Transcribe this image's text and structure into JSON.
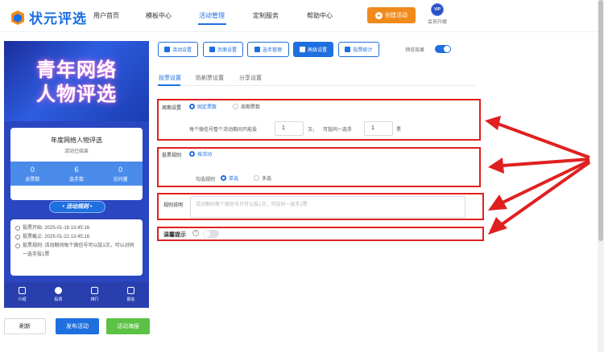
{
  "brand": {
    "name": "状元评选"
  },
  "nav": {
    "items": [
      {
        "label": "用户首页"
      },
      {
        "label": "模板中心"
      },
      {
        "label": "活动管理"
      },
      {
        "label": "定制服务"
      },
      {
        "label": "帮助中心"
      }
    ],
    "active_index": 2,
    "create_button": "创建活动",
    "vip_badge": "VIP",
    "vip_label": "会员升级"
  },
  "preview": {
    "hero_line1": "青年网络",
    "hero_line2": "人物评选",
    "title": "年度网络人物评选",
    "status": "活动已结束",
    "stats": [
      {
        "value": "0",
        "label": "总票数"
      },
      {
        "value": "6",
        "label": "选手数"
      },
      {
        "value": "0",
        "label": "访问量"
      }
    ],
    "rules_button": "• 活动规则 •",
    "info": [
      {
        "text": "投票开始: 2025-01-16 13:45:16"
      },
      {
        "text": "投票截止: 2025-01-22 13:45:16"
      },
      {
        "text": "投票规则: 活动期间每个微信号可以投1次，可以对同一选手投1票"
      }
    ],
    "tabs": [
      {
        "label": "介绍"
      },
      {
        "label": "投票"
      },
      {
        "label": "排行"
      },
      {
        "label": "报名"
      }
    ]
  },
  "bottom": {
    "refresh": "刷新",
    "publish": "发布活动",
    "poster": "活动海报"
  },
  "toolbar": {
    "buttons": [
      {
        "label": "活动设置"
      },
      {
        "label": "页面设置"
      },
      {
        "label": "选手管理"
      },
      {
        "label": "高级设置"
      },
      {
        "label": "投票统计"
      }
    ],
    "active_index": 3,
    "preview_label": "预览效果",
    "preview_on": true
  },
  "subtabs": [
    {
      "label": "投票设置"
    },
    {
      "label": "防刷票设置"
    },
    {
      "label": "分享设置"
    }
  ],
  "form": {
    "cycle_label": "周期设置",
    "cycle_options": [
      "固定票数",
      "周期票数"
    ],
    "cycle_text1": "每个微信号整个活动期间只能投",
    "votes_value": "1",
    "cycle_text2": "次，",
    "cycle_text3": "可投同一选手",
    "same_value": "1",
    "cycle_text4": "票",
    "rule_label": "投票规则",
    "rule_option": "按活动",
    "check_label": "勾选规则",
    "check_options": [
      "单选",
      "多选"
    ],
    "desc_label": "规则说明",
    "desc_placeholder": "活动期间每个微信号只可以投1次，可投同一选手1票",
    "tip_label": "温馨提示",
    "tip_help": "?",
    "tip_on": false
  },
  "colors": {
    "accent": "#1e6fe0",
    "highlight": "#e02020",
    "orange": "#f08a1c",
    "green": "#5bc245"
  }
}
